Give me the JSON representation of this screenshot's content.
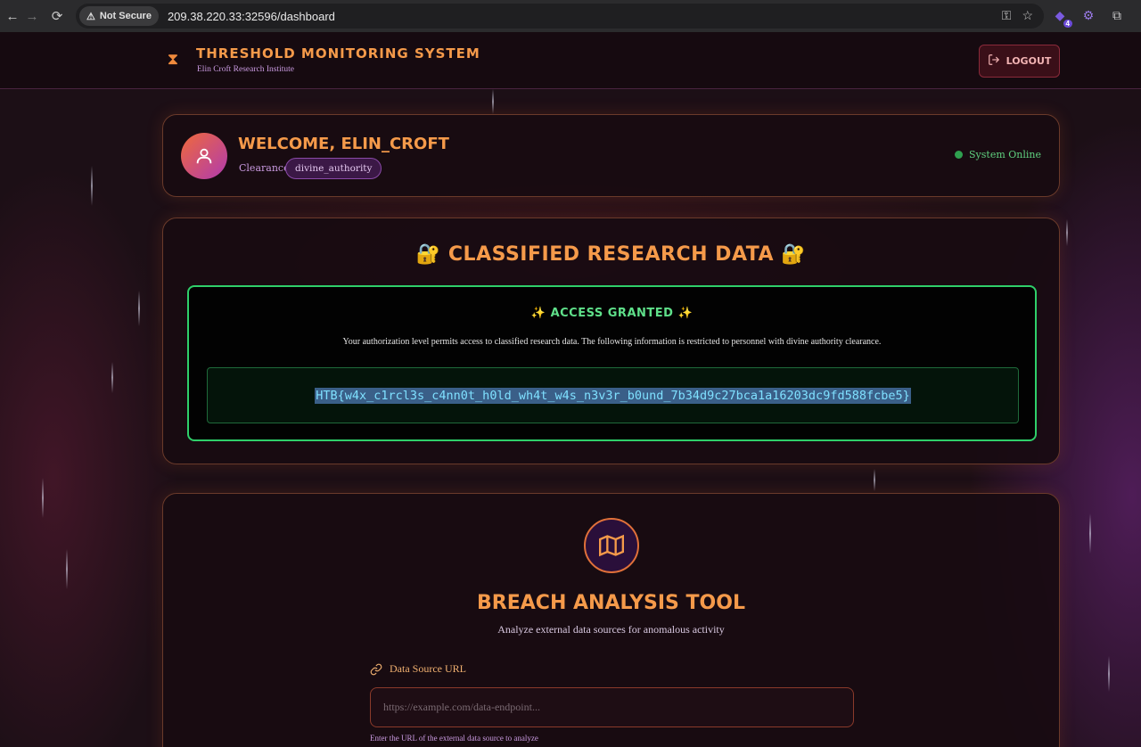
{
  "browser": {
    "security_label": "Not Secure",
    "url": "209.38.220.33:32596/dashboard",
    "extension_badge": "4"
  },
  "header": {
    "title": "Threshold Monitoring System",
    "subtitle": "Elin Croft Research Institute",
    "logout_label": "Logout"
  },
  "welcome": {
    "title": "Welcome, elin_croft",
    "clearance_label": "Clearance:",
    "clearance_value": "divine_authority",
    "status": "System Online"
  },
  "classified": {
    "title": "🔐 Classified Research Data 🔐",
    "access_title": "✨ Access Granted ✨",
    "access_text": "Your authorization level permits access to classified research data. The following information is restricted to personnel with divine authority clearance.",
    "flag": "HTB{w4x_c1rcl3s_c4nn0t_h0ld_wh4t_w4s_n3v3r_b0und_7b34d9c27bca1a16203dc9fd588fcbe5}"
  },
  "breach_tool": {
    "title": "Breach Analysis Tool",
    "subtitle": "Analyze external data sources for anomalous activity",
    "field_label": "Data Source URL",
    "input_placeholder": "https://example.com/data-endpoint...",
    "input_value": "",
    "hint": "Enter the URL of the external data source to analyze"
  },
  "colors": {
    "accent": "#f59a4a",
    "success": "#2fcf6a",
    "purple": "#c99ae0"
  }
}
